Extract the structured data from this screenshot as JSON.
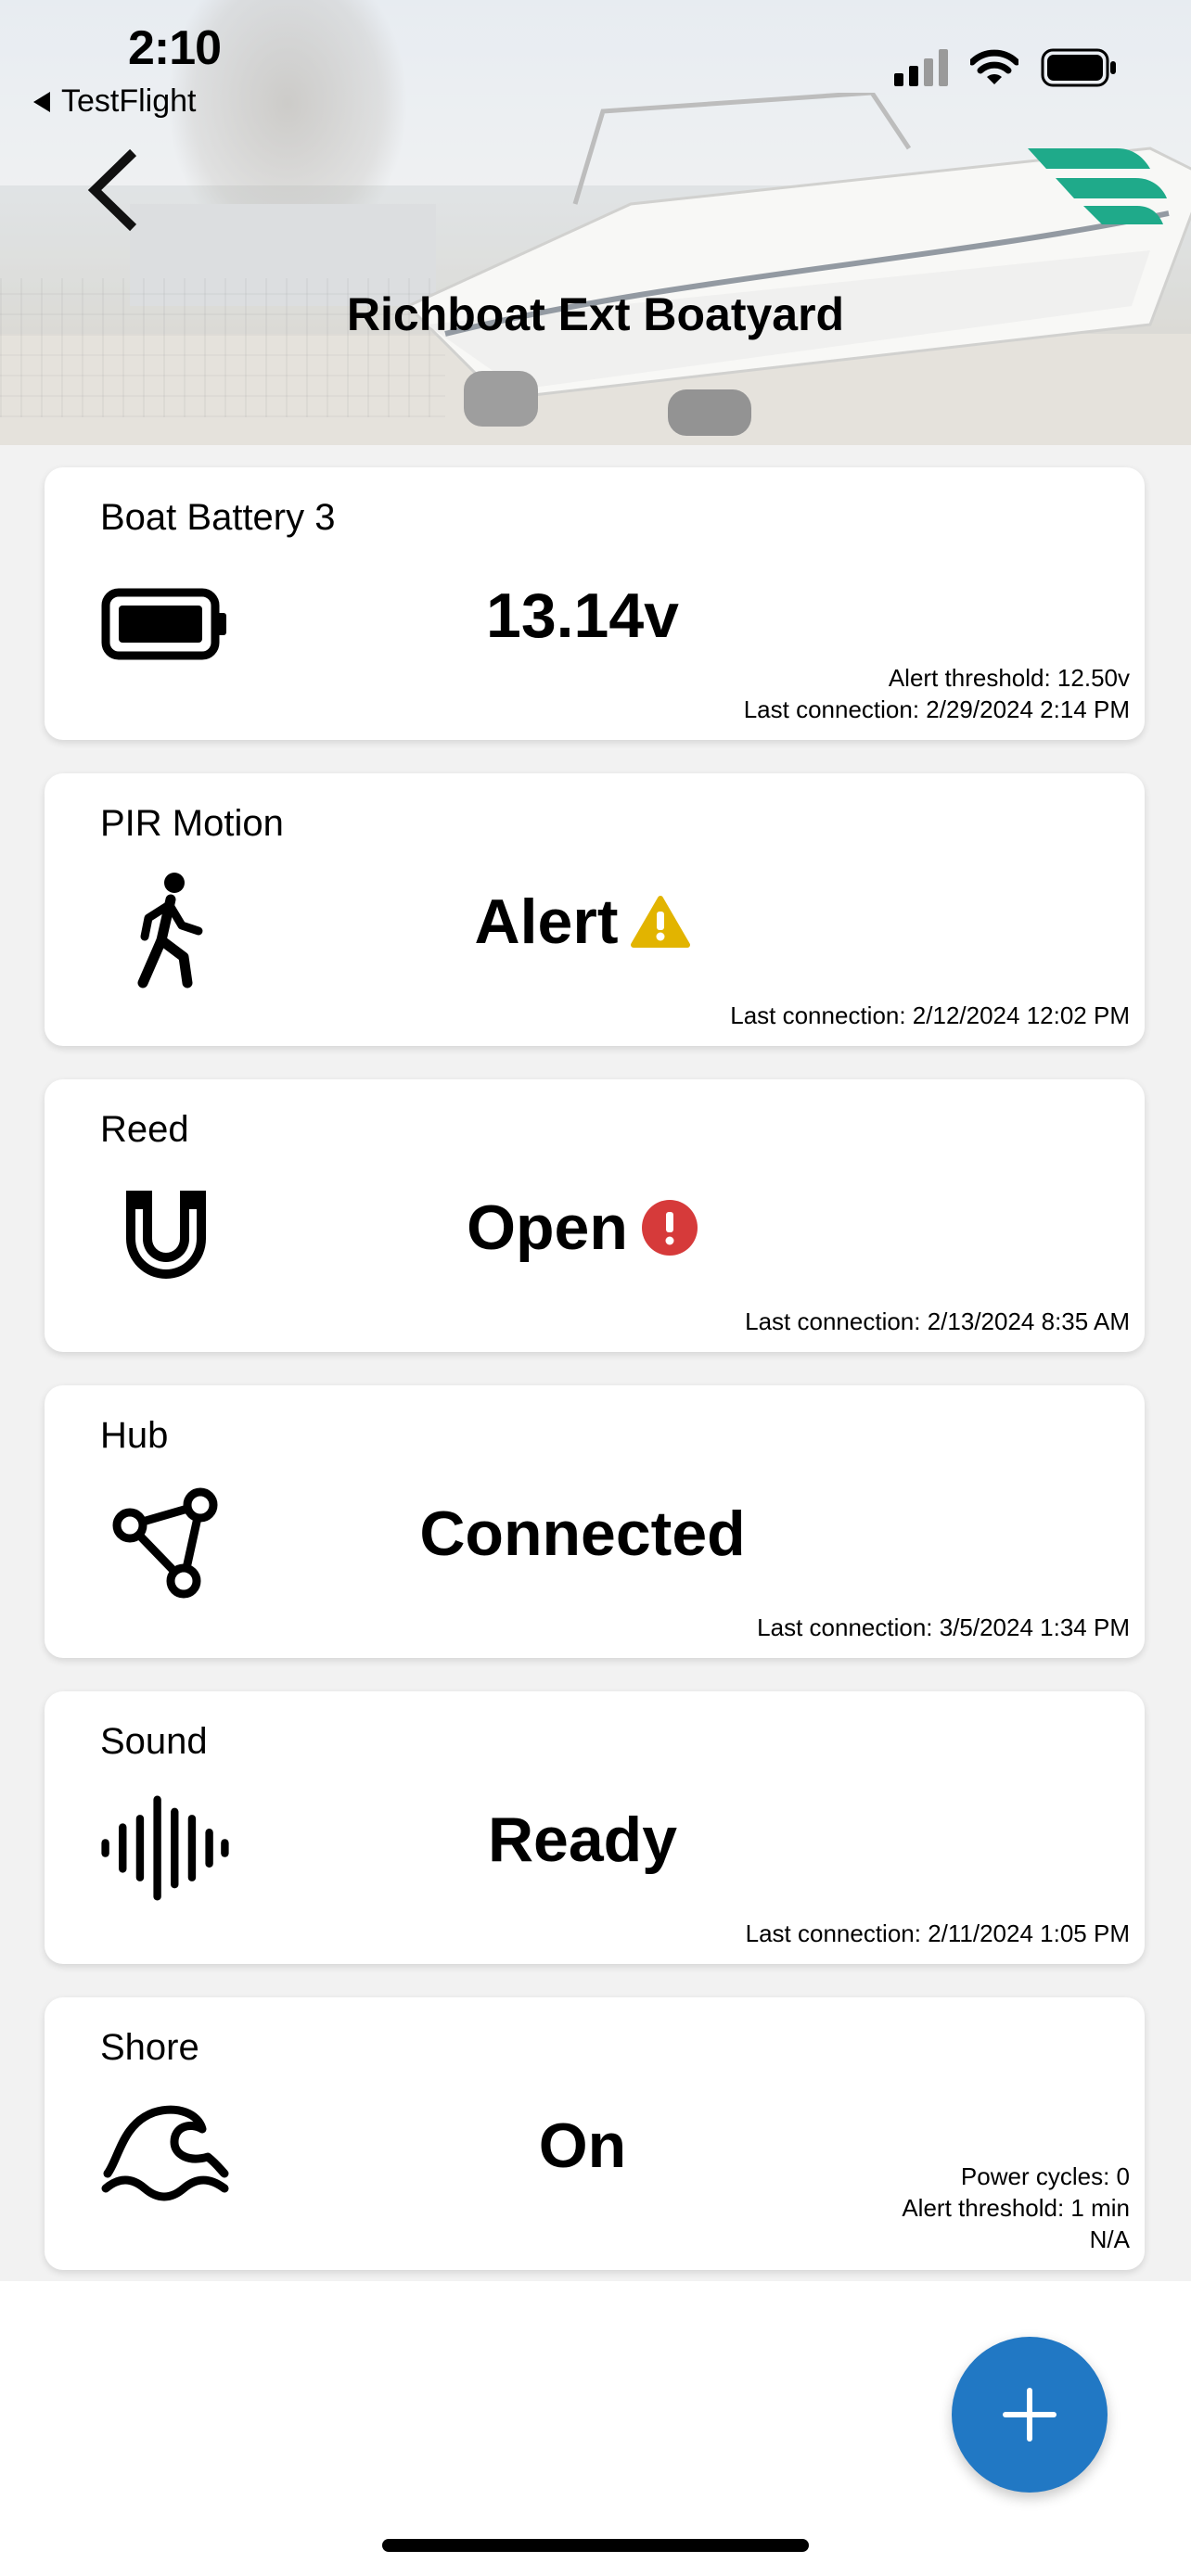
{
  "status_bar": {
    "time": "2:10",
    "back_app_label": "TestFlight",
    "icons": [
      "cellular-signal-icon",
      "wifi-icon",
      "battery-icon"
    ]
  },
  "header": {
    "title": "Richboat Ext Boatyard",
    "back_icon": "chevron-left-icon",
    "logo": "brand-logo"
  },
  "colors": {
    "accent": "#2178c4",
    "brand": "#1faa8a",
    "warning": "#e2b400",
    "danger": "#d63a3a"
  },
  "devices": [
    {
      "name": "Boat Battery 3",
      "icon": "battery-icon",
      "value": "13.14v",
      "status_icon": "",
      "meta": [
        "Alert threshold: 12.50v",
        "Last connection: 2/29/2024 2:14 PM"
      ]
    },
    {
      "name": "PIR Motion",
      "icon": "walking-person-icon",
      "value": "Alert",
      "status_icon": "warning-icon",
      "meta": [
        "Last connection: 2/12/2024 12:02 PM"
      ]
    },
    {
      "name": "Reed",
      "icon": "magnet-icon",
      "value": "Open",
      "status_icon": "error-icon",
      "meta": [
        "Last connection: 2/13/2024 8:35 AM"
      ]
    },
    {
      "name": "Hub",
      "icon": "network-hub-icon",
      "value": "Connected",
      "status_icon": "",
      "meta": [
        "Last connection: 3/5/2024 1:34 PM"
      ]
    },
    {
      "name": "Sound",
      "icon": "sound-wave-icon",
      "value": "Ready",
      "status_icon": "",
      "meta": [
        "Last connection: 2/11/2024 1:05 PM"
      ]
    },
    {
      "name": "Shore",
      "icon": "ocean-wave-icon",
      "value": "On",
      "status_icon": "",
      "meta": [
        "Power cycles: 0",
        "Alert threshold: 1 min",
        "N/A"
      ]
    }
  ],
  "fab": {
    "icon": "plus-icon"
  }
}
